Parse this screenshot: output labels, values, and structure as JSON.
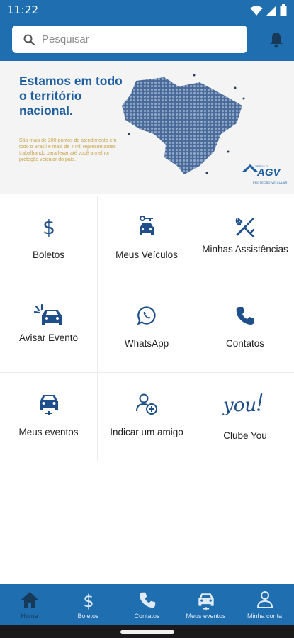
{
  "status": {
    "time": "11:22"
  },
  "search": {
    "placeholder": "Pesquisar"
  },
  "banner": {
    "title": "Estamos em todo o território nacional.",
    "body": "São mais de 200 pontos de atendimento em todo o Brasil e mais de 4 mil representantes trabalhando para levar até você a melhor proteção veicular do país.",
    "logo_text": "AGV",
    "logo_tagline": "PROTEÇÃO VEICULAR",
    "logo_small": "SEU VEÍCULO"
  },
  "menu": [
    {
      "label": "Boletos",
      "icon": "dollar-icon"
    },
    {
      "label": "Meus Veículos",
      "icon": "car-key-icon"
    },
    {
      "label": "Minhas Assistências",
      "icon": "tools-icon"
    },
    {
      "label": "Avisar Evento",
      "icon": "car-crash-icon"
    },
    {
      "label": "WhatsApp",
      "icon": "whatsapp-icon"
    },
    {
      "label": "Contatos",
      "icon": "phone-icon"
    },
    {
      "label": "Meus eventos",
      "icon": "car-front-icon"
    },
    {
      "label": "Indicar um amigo",
      "icon": "add-user-icon"
    },
    {
      "label": "Clube You",
      "icon": "you-logo-icon"
    }
  ],
  "tabs": [
    {
      "label": "Home",
      "icon": "home-icon"
    },
    {
      "label": "Boletos",
      "icon": "dollar-icon"
    },
    {
      "label": "Contatos",
      "icon": "phone-icon"
    },
    {
      "label": "Meus eventos",
      "icon": "car-icon"
    },
    {
      "label": "Minha conta",
      "icon": "person-icon"
    }
  ],
  "colors": {
    "primary": "#1f6fb0",
    "icon_blue": "#1f4f8a",
    "banner_text": "#1f5fa0",
    "banner_gold": "#c9a44a"
  }
}
